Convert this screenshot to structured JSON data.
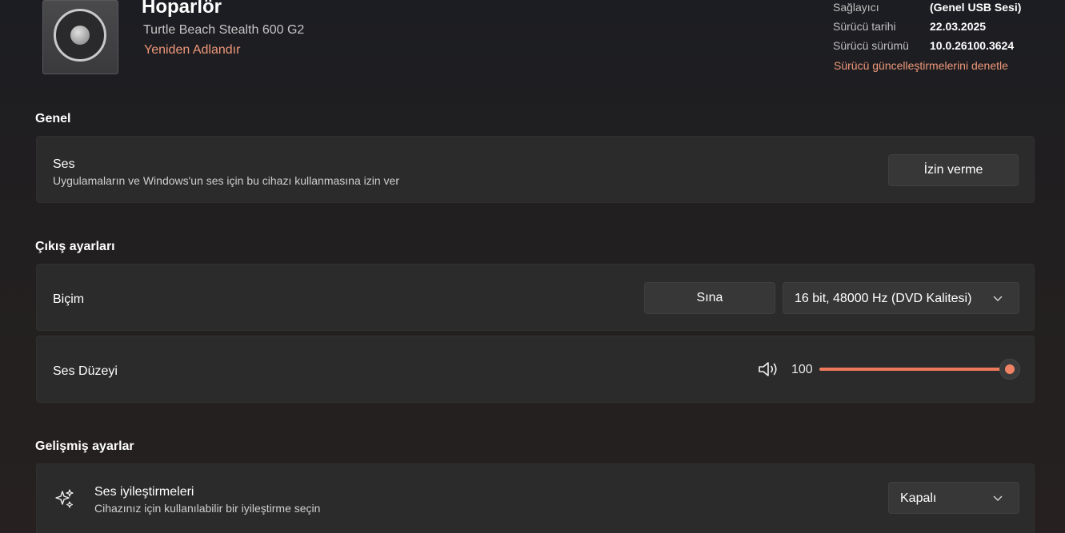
{
  "header": {
    "device_name": "Hoparlör",
    "device_model": "Turtle Beach Stealth 600 G2",
    "rename_link": "Yeniden Adlandır",
    "device_icon": "speaker-icon"
  },
  "driver_info": {
    "provider_label": "Sağlayıcı",
    "provider_value": "(Genel USB Sesi)",
    "date_label": "Sürücü tarihi",
    "date_value": "22.03.2025",
    "version_label": "Sürücü sürümü",
    "version_value": "10.0.26100.3624",
    "update_link": "Sürücü güncelleştirmelerini denetle"
  },
  "general": {
    "section_title": "Genel",
    "audio_title": "Ses",
    "audio_desc": "Uygulamaların ve Windows'un ses için bu cihazı kullanmasına izin ver",
    "deny_button": "İzin verme"
  },
  "output": {
    "section_title": "Çıkış ayarları",
    "format_label": "Biçim",
    "test_button": "Sına",
    "format_value": "16 bit, 48000 Hz (DVD Kalitesi)",
    "volume_label": "Ses Düzeyi",
    "volume_value": "100",
    "volume_level_percent": 100,
    "volume_icon": "speaker-volume-icon"
  },
  "advanced": {
    "section_title": "Gelişmiş ayarlar",
    "enhancements_title": "Ses iyileştirmeleri",
    "enhancements_desc": "Cihazınız için kullanılabilir bir iyileştirme seçin",
    "enhancements_value": "Kapalı",
    "enhancements_icon": "sparkle-icon"
  },
  "colors": {
    "accent": "#f0987a",
    "slider_fill": "#ed7a5c",
    "card_bg": "#2b2b2b"
  }
}
